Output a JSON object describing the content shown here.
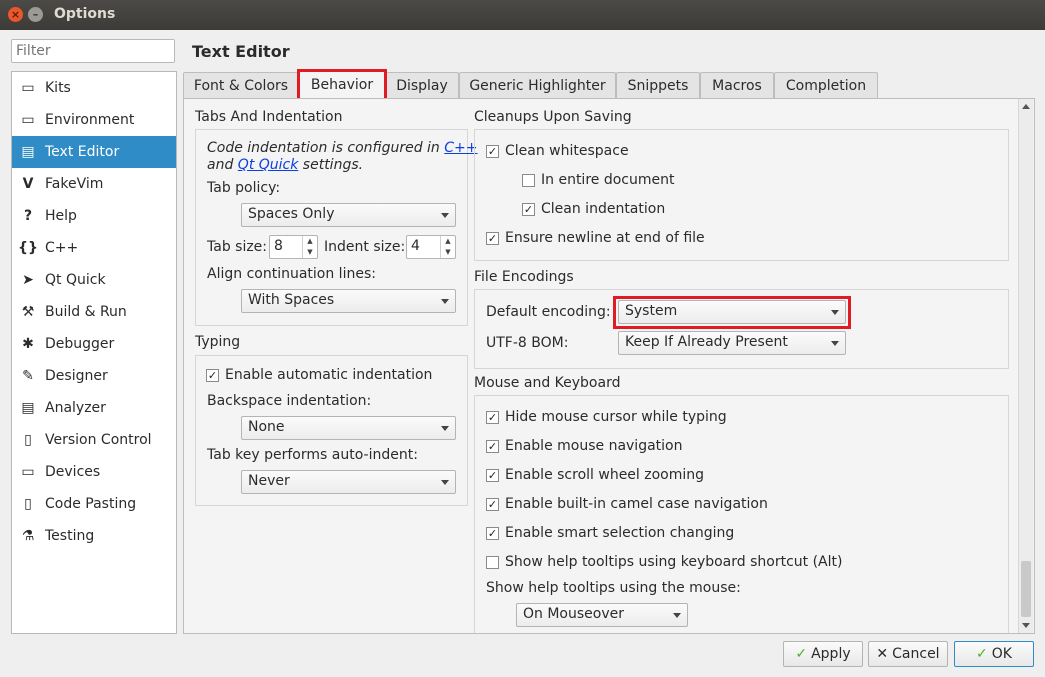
{
  "window": {
    "title": "Options"
  },
  "filter": {
    "placeholder": "Filter"
  },
  "nav": [
    {
      "label": "Kits",
      "icon": "kits-icon",
      "glyph": "▭"
    },
    {
      "label": "Environment",
      "icon": "monitor-icon",
      "glyph": "▭"
    },
    {
      "label": "Text Editor",
      "icon": "text-editor-icon",
      "glyph": "▤"
    },
    {
      "label": "FakeVim",
      "icon": "fakevim-icon",
      "glyph": "V"
    },
    {
      "label": "Help",
      "icon": "help-icon",
      "glyph": "?"
    },
    {
      "label": "C++",
      "icon": "braces-icon",
      "glyph": "{}"
    },
    {
      "label": "Qt Quick",
      "icon": "qtquick-icon",
      "glyph": "➤"
    },
    {
      "label": "Build & Run",
      "icon": "hammer-icon",
      "glyph": "⚒"
    },
    {
      "label": "Debugger",
      "icon": "bug-icon",
      "glyph": "✱"
    },
    {
      "label": "Designer",
      "icon": "pencil-icon",
      "glyph": "✎"
    },
    {
      "label": "Analyzer",
      "icon": "analyzer-icon",
      "glyph": "▤"
    },
    {
      "label": "Version Control",
      "icon": "version-control-icon",
      "glyph": "▯"
    },
    {
      "label": "Devices",
      "icon": "devices-icon",
      "glyph": "▭"
    },
    {
      "label": "Code Pasting",
      "icon": "code-pasting-icon",
      "glyph": "▯"
    },
    {
      "label": "Testing",
      "icon": "testing-icon",
      "glyph": "⚗"
    }
  ],
  "page_title": "Text Editor",
  "tabs": [
    "Font & Colors",
    "Behavior",
    "Display",
    "Generic Highlighter",
    "Snippets",
    "Macros",
    "Completion"
  ],
  "tabs_indent": {
    "title": "Tabs And Indentation",
    "note_prefix": "Code indentation is configured in ",
    "note_link1": "C++",
    "note_mid": "and ",
    "note_link2": "Qt Quick",
    "note_suffix": " settings.",
    "tab_policy_label": "Tab policy:",
    "tab_policy_value": "Spaces Only",
    "tab_size_label": "Tab size:",
    "tab_size_value": "8",
    "indent_size_label": "Indent size:",
    "indent_size_value": "4",
    "align_label": "Align continuation lines:",
    "align_value": "With Spaces"
  },
  "typing": {
    "title": "Typing",
    "auto_indent_label": "Enable automatic indentation",
    "backspace_label": "Backspace indentation:",
    "backspace_value": "None",
    "tabkey_label": "Tab key performs auto-indent:",
    "tabkey_value": "Never"
  },
  "cleanups": {
    "title": "Cleanups Upon Saving",
    "clean_whitespace": "Clean whitespace",
    "entire_document": "In entire document",
    "clean_indentation": "Clean indentation",
    "ensure_newline": "Ensure newline at end of file"
  },
  "encodings": {
    "title": "File Encodings",
    "default_label": "Default encoding:",
    "default_value": "System",
    "bom_label": "UTF-8 BOM:",
    "bom_value": "Keep If Already Present"
  },
  "mouse": {
    "title": "Mouse and Keyboard",
    "hide_cursor": "Hide mouse cursor while typing",
    "mouse_nav": "Enable mouse navigation",
    "scroll_zoom": "Enable scroll wheel zooming",
    "camel_nav": "Enable built-in camel case navigation",
    "smart_sel": "Enable smart selection changing",
    "help_kbd": "Show help tooltips using keyboard shortcut (Alt)",
    "help_mouse_label": "Show help tooltips using the mouse:",
    "help_mouse_value": "On Mouseover"
  },
  "buttons": {
    "apply": "Apply",
    "cancel": "Cancel",
    "ok": "OK"
  },
  "colors": {
    "accent": "#308cc6",
    "highlight": "#e01b24",
    "link": "#0b3ee3"
  }
}
